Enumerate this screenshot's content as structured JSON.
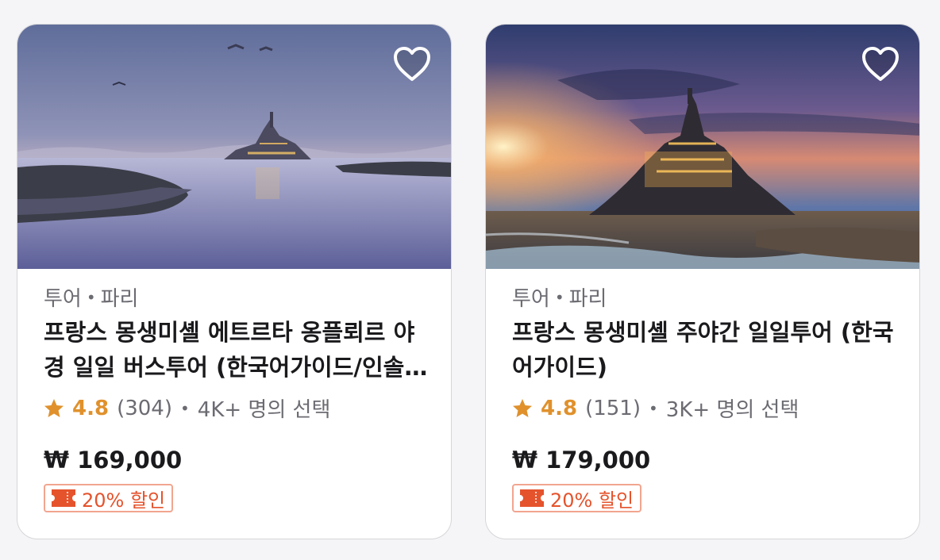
{
  "cards": [
    {
      "category": "투어",
      "location": "파리",
      "title": "프랑스 몽생미셸 에트르타 옹플뢰르 야경 일일 버스투어 (한국어가이드/인솔자)",
      "rating": "4.8",
      "reviews": "(304)",
      "chosen": "4K+ 명의 선택",
      "price": "₩ 169,000",
      "discount": "20% 할인",
      "photo": "mont-saint-michel-dusk-photo"
    },
    {
      "category": "투어",
      "location": "파리",
      "title": "프랑스 몽생미셸 주야간 일일투어 (한국어가이드)",
      "rating": "4.8",
      "reviews": "(151)",
      "chosen": "3K+ 명의 선택",
      "price": "₩ 179,000",
      "discount": "20% 할인",
      "photo": "mont-saint-michel-sunset-photo"
    }
  ],
  "colors": {
    "rating_star": "#e0912c",
    "discount": "#e5532c",
    "discount_border": "#f2a58f",
    "text_primary": "#1a1a1d",
    "text_secondary": "#6b6b72"
  },
  "icons": {
    "wishlist": "heart-outline-icon",
    "rating": "star-icon",
    "coupon": "ticket-icon"
  }
}
